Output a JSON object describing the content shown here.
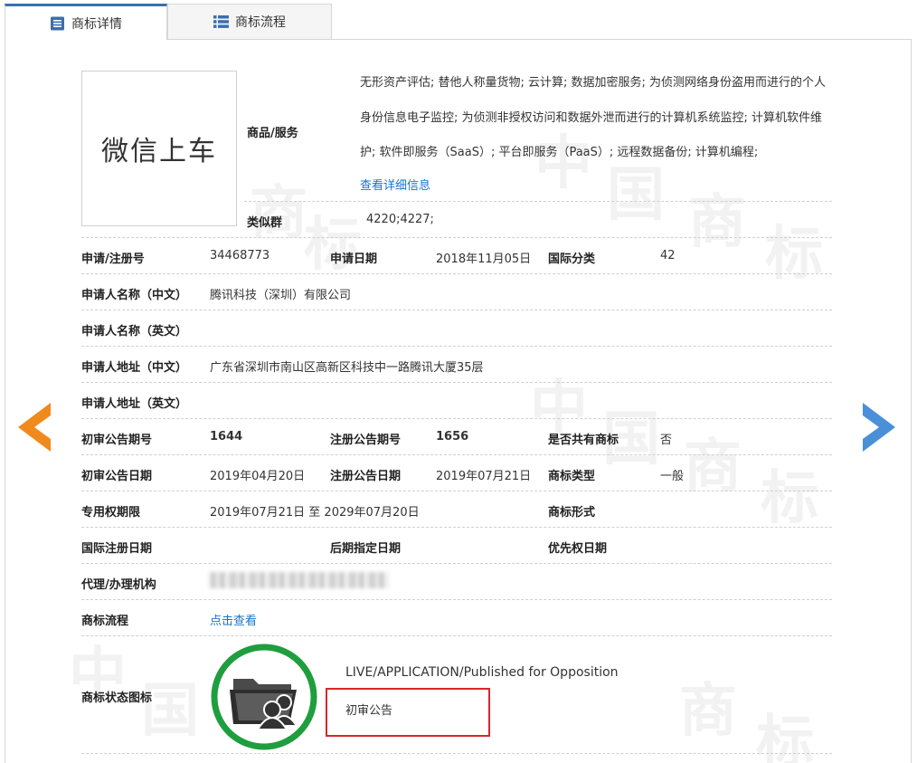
{
  "tabs": [
    {
      "label": "商标详情",
      "active": true
    },
    {
      "label": "商标流程",
      "active": false
    }
  ],
  "watermark": [
    "商",
    "标",
    "中",
    "国",
    "商",
    "标",
    "中",
    "国"
  ],
  "logo_text": "微信上车",
  "goods": {
    "label": "商品/服务",
    "text": "无形资产评估; 替他人称量货物; 云计算; 数据加密服务; 为侦测网络身份盗用而进行的个人身份信息电子监控; 为侦测非授权访问和数据外泄而进行的计算机系统监控; 计算机软件维护; 软件即服务（SaaS）; 平台即服务（PaaS）; 远程数据备份; 计算机编程;",
    "more_link": "查看详细信息"
  },
  "similar_group": {
    "label": "类似群",
    "value": "4220;4227;"
  },
  "fields": {
    "reg_no": {
      "label": "申请/注册号",
      "value": "34468773"
    },
    "apply_date": {
      "label": "申请日期",
      "value": "2018年11月05日"
    },
    "intl_class": {
      "label": "国际分类",
      "value": "42"
    },
    "applicant_cn": {
      "label": "申请人名称（中文）",
      "value": "腾讯科技（深圳）有限公司"
    },
    "applicant_en": {
      "label": "申请人名称（英文）",
      "value": ""
    },
    "address_cn": {
      "label": "申请人地址（中文）",
      "value": "广东省深圳市南山区高新区科技中一路腾讯大厦35层"
    },
    "address_en": {
      "label": "申请人地址（英文）",
      "value": ""
    },
    "prelim_issue": {
      "label": "初审公告期号",
      "value": "1644"
    },
    "reg_issue": {
      "label": "注册公告期号",
      "value": "1656"
    },
    "shared": {
      "label": "是否共有商标",
      "value": "否"
    },
    "prelim_date": {
      "label": "初审公告日期",
      "value": "2019年04月20日"
    },
    "reg_date": {
      "label": "注册公告日期",
      "value": "2019年07月21日"
    },
    "mark_type": {
      "label": "商标类型",
      "value": "一般"
    },
    "exclusive_period": {
      "label": "专用权期限",
      "value": "2019年07月21日 至 2029年07月20日"
    },
    "mark_form": {
      "label": "商标形式",
      "value": ""
    },
    "intl_reg_date": {
      "label": "国际注册日期",
      "value": ""
    },
    "later_designation": {
      "label": "后期指定日期",
      "value": ""
    },
    "priority_date": {
      "label": "优先权日期",
      "value": ""
    },
    "agent": {
      "label": "代理/办理机构",
      "value": ""
    },
    "process": {
      "label": "商标流程",
      "link": "点击查看"
    },
    "status_icon": {
      "label": "商标状态图标"
    }
  },
  "status": {
    "en": "LIVE/APPLICATION/Published for Opposition",
    "cn": "初审公告",
    "ring_color": "#1e9e3e",
    "highlight_color": "#d9262b"
  },
  "nav": {
    "prev_color": "#f08a1c",
    "next_color": "#4a90d9"
  }
}
